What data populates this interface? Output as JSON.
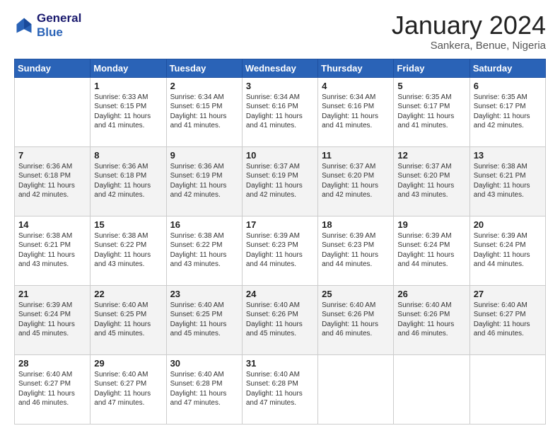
{
  "header": {
    "logo_line1": "General",
    "logo_line2": "Blue",
    "month": "January 2024",
    "location": "Sankera, Benue, Nigeria"
  },
  "days_of_week": [
    "Sunday",
    "Monday",
    "Tuesday",
    "Wednesday",
    "Thursday",
    "Friday",
    "Saturday"
  ],
  "weeks": [
    [
      {
        "day": "",
        "sunrise": "",
        "sunset": "",
        "daylight": ""
      },
      {
        "day": "1",
        "sunrise": "Sunrise: 6:33 AM",
        "sunset": "Sunset: 6:15 PM",
        "daylight": "Daylight: 11 hours and 41 minutes."
      },
      {
        "day": "2",
        "sunrise": "Sunrise: 6:34 AM",
        "sunset": "Sunset: 6:15 PM",
        "daylight": "Daylight: 11 hours and 41 minutes."
      },
      {
        "day": "3",
        "sunrise": "Sunrise: 6:34 AM",
        "sunset": "Sunset: 6:16 PM",
        "daylight": "Daylight: 11 hours and 41 minutes."
      },
      {
        "day": "4",
        "sunrise": "Sunrise: 6:34 AM",
        "sunset": "Sunset: 6:16 PM",
        "daylight": "Daylight: 11 hours and 41 minutes."
      },
      {
        "day": "5",
        "sunrise": "Sunrise: 6:35 AM",
        "sunset": "Sunset: 6:17 PM",
        "daylight": "Daylight: 11 hours and 41 minutes."
      },
      {
        "day": "6",
        "sunrise": "Sunrise: 6:35 AM",
        "sunset": "Sunset: 6:17 PM",
        "daylight": "Daylight: 11 hours and 42 minutes."
      }
    ],
    [
      {
        "day": "7",
        "sunrise": "Sunrise: 6:36 AM",
        "sunset": "Sunset: 6:18 PM",
        "daylight": "Daylight: 11 hours and 42 minutes."
      },
      {
        "day": "8",
        "sunrise": "Sunrise: 6:36 AM",
        "sunset": "Sunset: 6:18 PM",
        "daylight": "Daylight: 11 hours and 42 minutes."
      },
      {
        "day": "9",
        "sunrise": "Sunrise: 6:36 AM",
        "sunset": "Sunset: 6:19 PM",
        "daylight": "Daylight: 11 hours and 42 minutes."
      },
      {
        "day": "10",
        "sunrise": "Sunrise: 6:37 AM",
        "sunset": "Sunset: 6:19 PM",
        "daylight": "Daylight: 11 hours and 42 minutes."
      },
      {
        "day": "11",
        "sunrise": "Sunrise: 6:37 AM",
        "sunset": "Sunset: 6:20 PM",
        "daylight": "Daylight: 11 hours and 42 minutes."
      },
      {
        "day": "12",
        "sunrise": "Sunrise: 6:37 AM",
        "sunset": "Sunset: 6:20 PM",
        "daylight": "Daylight: 11 hours and 43 minutes."
      },
      {
        "day": "13",
        "sunrise": "Sunrise: 6:38 AM",
        "sunset": "Sunset: 6:21 PM",
        "daylight": "Daylight: 11 hours and 43 minutes."
      }
    ],
    [
      {
        "day": "14",
        "sunrise": "Sunrise: 6:38 AM",
        "sunset": "Sunset: 6:21 PM",
        "daylight": "Daylight: 11 hours and 43 minutes."
      },
      {
        "day": "15",
        "sunrise": "Sunrise: 6:38 AM",
        "sunset": "Sunset: 6:22 PM",
        "daylight": "Daylight: 11 hours and 43 minutes."
      },
      {
        "day": "16",
        "sunrise": "Sunrise: 6:38 AM",
        "sunset": "Sunset: 6:22 PM",
        "daylight": "Daylight: 11 hours and 43 minutes."
      },
      {
        "day": "17",
        "sunrise": "Sunrise: 6:39 AM",
        "sunset": "Sunset: 6:23 PM",
        "daylight": "Daylight: 11 hours and 44 minutes."
      },
      {
        "day": "18",
        "sunrise": "Sunrise: 6:39 AM",
        "sunset": "Sunset: 6:23 PM",
        "daylight": "Daylight: 11 hours and 44 minutes."
      },
      {
        "day": "19",
        "sunrise": "Sunrise: 6:39 AM",
        "sunset": "Sunset: 6:24 PM",
        "daylight": "Daylight: 11 hours and 44 minutes."
      },
      {
        "day": "20",
        "sunrise": "Sunrise: 6:39 AM",
        "sunset": "Sunset: 6:24 PM",
        "daylight": "Daylight: 11 hours and 44 minutes."
      }
    ],
    [
      {
        "day": "21",
        "sunrise": "Sunrise: 6:39 AM",
        "sunset": "Sunset: 6:24 PM",
        "daylight": "Daylight: 11 hours and 45 minutes."
      },
      {
        "day": "22",
        "sunrise": "Sunrise: 6:40 AM",
        "sunset": "Sunset: 6:25 PM",
        "daylight": "Daylight: 11 hours and 45 minutes."
      },
      {
        "day": "23",
        "sunrise": "Sunrise: 6:40 AM",
        "sunset": "Sunset: 6:25 PM",
        "daylight": "Daylight: 11 hours and 45 minutes."
      },
      {
        "day": "24",
        "sunrise": "Sunrise: 6:40 AM",
        "sunset": "Sunset: 6:26 PM",
        "daylight": "Daylight: 11 hours and 45 minutes."
      },
      {
        "day": "25",
        "sunrise": "Sunrise: 6:40 AM",
        "sunset": "Sunset: 6:26 PM",
        "daylight": "Daylight: 11 hours and 46 minutes."
      },
      {
        "day": "26",
        "sunrise": "Sunrise: 6:40 AM",
        "sunset": "Sunset: 6:26 PM",
        "daylight": "Daylight: 11 hours and 46 minutes."
      },
      {
        "day": "27",
        "sunrise": "Sunrise: 6:40 AM",
        "sunset": "Sunset: 6:27 PM",
        "daylight": "Daylight: 11 hours and 46 minutes."
      }
    ],
    [
      {
        "day": "28",
        "sunrise": "Sunrise: 6:40 AM",
        "sunset": "Sunset: 6:27 PM",
        "daylight": "Daylight: 11 hours and 46 minutes."
      },
      {
        "day": "29",
        "sunrise": "Sunrise: 6:40 AM",
        "sunset": "Sunset: 6:27 PM",
        "daylight": "Daylight: 11 hours and 47 minutes."
      },
      {
        "day": "30",
        "sunrise": "Sunrise: 6:40 AM",
        "sunset": "Sunset: 6:28 PM",
        "daylight": "Daylight: 11 hours and 47 minutes."
      },
      {
        "day": "31",
        "sunrise": "Sunrise: 6:40 AM",
        "sunset": "Sunset: 6:28 PM",
        "daylight": "Daylight: 11 hours and 47 minutes."
      },
      {
        "day": "",
        "sunrise": "",
        "sunset": "",
        "daylight": ""
      },
      {
        "day": "",
        "sunrise": "",
        "sunset": "",
        "daylight": ""
      },
      {
        "day": "",
        "sunrise": "",
        "sunset": "",
        "daylight": ""
      }
    ]
  ]
}
